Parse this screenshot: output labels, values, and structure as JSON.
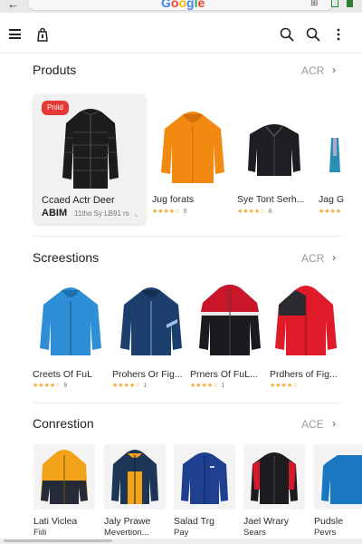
{
  "browser": {
    "logo": [
      "G",
      "o",
      "o",
      "g",
      "l",
      "e"
    ],
    "back_icon": "back-arrow-icon"
  },
  "header": {
    "icons": [
      "menu-icon",
      "shopping-bag-icon",
      "search-icon",
      "search-icon",
      "more-vertical-icon"
    ]
  },
  "sections": [
    {
      "title": "Produts",
      "more_label": "ACR",
      "featured": {
        "badge": "Pniid",
        "name": "Ccaed Actr Deer",
        "code": "ABIM",
        "meta": "11tho Sy LB91 rs",
        "pin": "⌞"
      },
      "items": [
        {
          "name": "Jug forats",
          "stars": "★★★★☆",
          "count": "9",
          "color": "#f28a12"
        },
        {
          "name": "Sye Tont Serh...",
          "stars": "★★★★☆",
          "count": "8",
          "color": "#1e1e22"
        },
        {
          "name": "Jag G",
          "stars": "★★★★",
          "count": "",
          "color": "#2a8fb3"
        }
      ]
    },
    {
      "title": "Screestions",
      "more_label": "ACR",
      "items": [
        {
          "name": "Creets Of FuL",
          "stars": "★★★★☆",
          "count": "9",
          "color": "#2f8fd6"
        },
        {
          "name": "Prohers Or Fig...",
          "stars": "★★★★☆",
          "count": "1",
          "color": "#1d3f6e"
        },
        {
          "name": "Prners Of FuL...",
          "stars": "★★★★☆",
          "count": "1",
          "color": "#c9162a"
        },
        {
          "name": "Prdhers of Fig...",
          "stars": "★★★★☆",
          "count": "",
          "color": "#e11a2a"
        }
      ]
    },
    {
      "title": "Conrestion",
      "more_label": "ACE",
      "items": [
        {
          "name": "Lati Viclea",
          "sub": "Fiili",
          "color": "#f2a31a"
        },
        {
          "name": "Jaly Prawe",
          "sub": "Mevertion...",
          "color": "#1d3556"
        },
        {
          "name": "Salad Trg",
          "sub": "Pay",
          "color": "#1f3f8f"
        },
        {
          "name": "Jael Wrary",
          "sub": "Sears",
          "color": "#1b1b20"
        },
        {
          "name": "Pudsle",
          "sub": "Pevrs",
          "color": "#1a78c2"
        }
      ]
    }
  ],
  "colors": {
    "accent_red": "#e53935",
    "star": "#f4a62a",
    "divider": "#ececec"
  }
}
